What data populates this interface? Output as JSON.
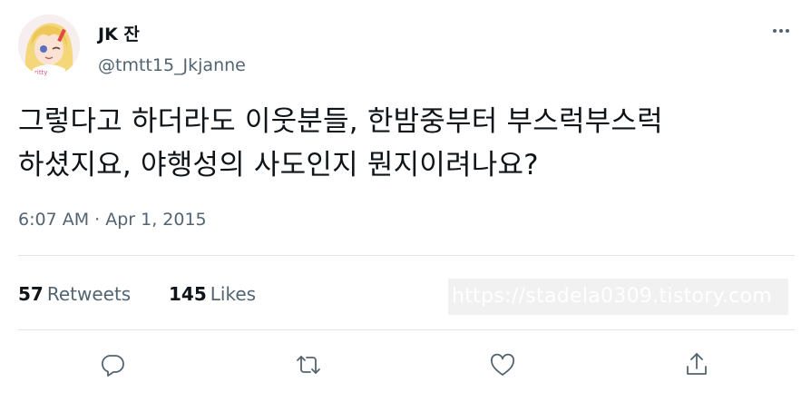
{
  "author": {
    "display_name": "JK 잔",
    "handle": "@tmtt15_Jkjanne"
  },
  "tweet": {
    "text_lines": [
      "그렇다고 하더라도 이웃분들, 한밤중부터 부스럭부스럭",
      "하셨지요, 야행성의 사도인지 뭔지이려나요?"
    ],
    "timestamp": "6:07 AM · Apr 1, 2015"
  },
  "stats": {
    "retweets_count": "57",
    "retweets_label": "Retweets",
    "likes_count": "145",
    "likes_label": "Likes"
  },
  "watermark": "https://stadela0309.tistory.com",
  "actions": {
    "reply_icon": "reply-icon",
    "retweet_icon": "retweet-icon",
    "like_icon": "heart-icon",
    "share_icon": "share-icon"
  },
  "colors": {
    "text_primary": "#0f1419",
    "text_secondary": "#536471",
    "divider": "#e2e6ea"
  }
}
